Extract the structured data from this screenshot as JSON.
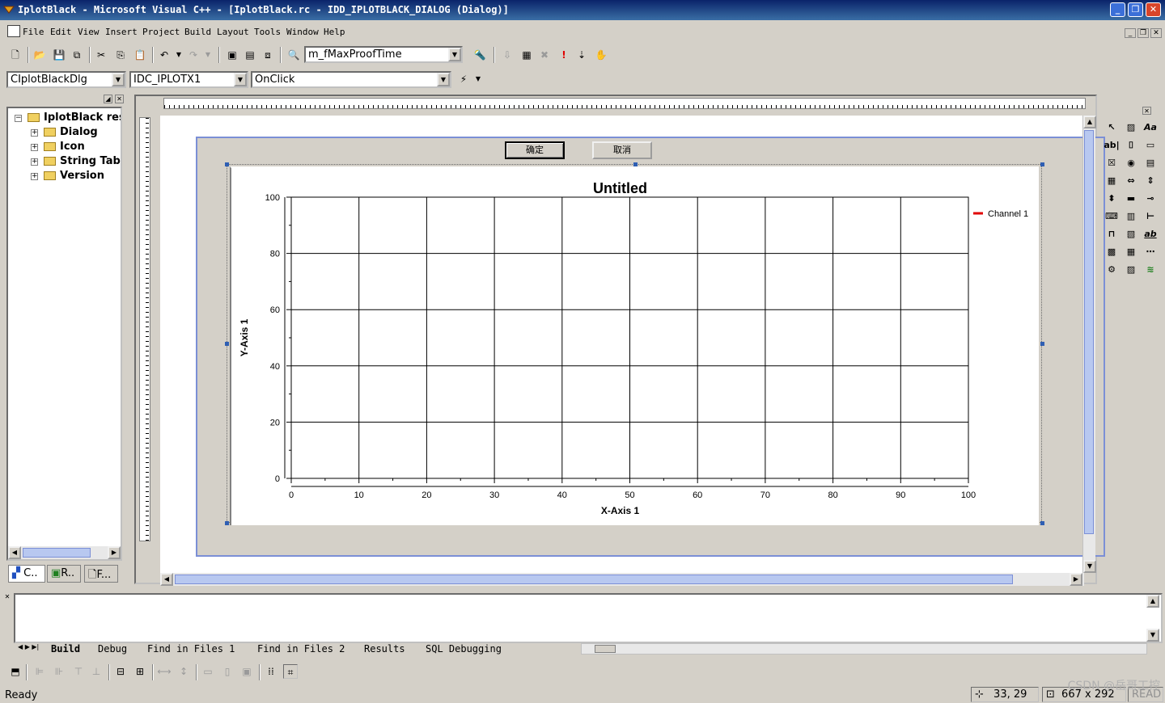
{
  "window": {
    "title": "IplotBlack - Microsoft Visual C++ - [IplotBlack.rc - IDD_IPLOTBLACK_DIALOG (Dialog)]",
    "caption_buttons": [
      "minimize-icon",
      "restore-icon",
      "close-icon"
    ]
  },
  "menu": {
    "items": [
      "File",
      "Edit",
      "View",
      "Insert",
      "Project",
      "Build",
      "Layout",
      "Tools",
      "Window",
      "Help"
    ]
  },
  "toolbar": {
    "member_combo": "m_fMaxProofTime"
  },
  "wizardbar": {
    "class_combo": "CIplotBlackDlg",
    "id_combo": "IDC_IPLOTX1",
    "handler_combo": "OnClick"
  },
  "workspace": {
    "root": "IplotBlack reso",
    "items": [
      "Dialog",
      "Icon",
      "String Table",
      "Version"
    ],
    "tabs": [
      "C..",
      "R..",
      "F..."
    ]
  },
  "dialog": {
    "ok_label": "确定",
    "cancel_label": "取消"
  },
  "chart_data": {
    "type": "line",
    "title": "Untitled",
    "xlabel": "X-Axis 1",
    "ylabel": "Y-Axis 1",
    "xlim": [
      0,
      100
    ],
    "ylim": [
      0,
      100
    ],
    "x_ticks": [
      "0",
      "10",
      "20",
      "30",
      "40",
      "50",
      "60",
      "70",
      "80",
      "90",
      "100"
    ],
    "y_ticks": [
      "0",
      "20",
      "40",
      "60",
      "80",
      "100"
    ],
    "grid": true,
    "legend_position": "top-right",
    "series": [
      {
        "name": "Channel 1",
        "color": "#e00000",
        "x": [],
        "y": []
      }
    ]
  },
  "output": {
    "tabs": [
      "Build",
      "Debug",
      "Find in Files 1",
      "Find in Files 2",
      "Results",
      "SQL Debugging"
    ]
  },
  "status": {
    "text": "Ready",
    "position": "33, 29",
    "size": "667 x 292",
    "mode": "READ"
  },
  "watermark": "CSDN @岳哥工控"
}
